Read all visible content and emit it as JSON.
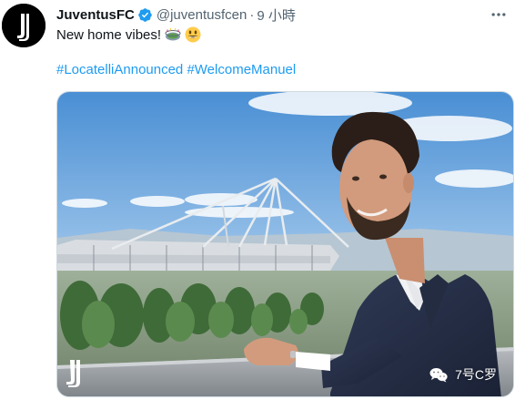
{
  "tweet": {
    "display_name": "JuventusFC",
    "handle": "@juventusfcen",
    "separator": "·",
    "time": "9 小時",
    "text": "New home vibes!",
    "emojis": [
      "stadium-emoji",
      "smiling-face-emoji"
    ],
    "hashtags": [
      "#LocatelliAnnounced",
      "#WelcomeManuel"
    ],
    "media": {
      "watermark_icon": "juventus-logo",
      "credit_text": "7号C罗",
      "credit_icon": "wechat-icon"
    }
  },
  "colors": {
    "text_primary": "#0f1419",
    "text_secondary": "#536471",
    "link": "#1d9bf0",
    "verified": "#1d9bf0",
    "avatar_bg": "#000000"
  }
}
